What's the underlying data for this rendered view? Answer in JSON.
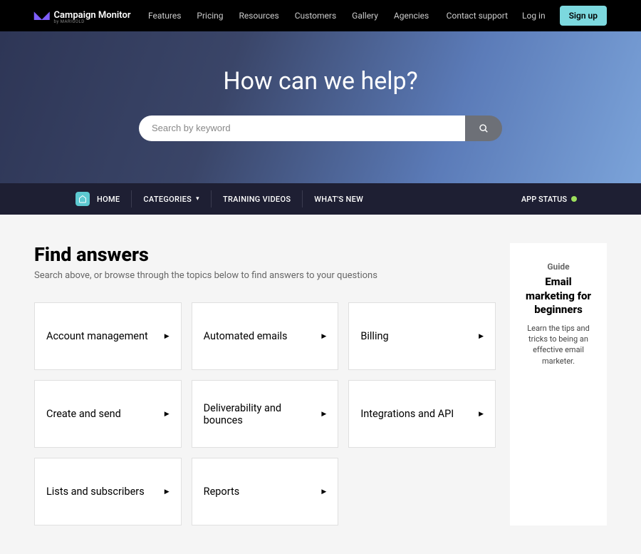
{
  "header": {
    "logo_text": "Campaign Monitor",
    "logo_sub": "by MARIGOLD",
    "nav": [
      "Features",
      "Pricing",
      "Resources",
      "Customers",
      "Gallery",
      "Agencies"
    ],
    "contact": "Contact support",
    "login": "Log in",
    "signup": "Sign up"
  },
  "hero": {
    "title": "How can we help?",
    "search_placeholder": "Search by keyword"
  },
  "subnav": {
    "home": "HOME",
    "categories": "CATEGORIES",
    "training": "TRAINING VIDEOS",
    "whatsnew": "WHAT'S NEW",
    "app_status": "APP STATUS"
  },
  "main": {
    "title": "Find answers",
    "subtitle": "Search above, or browse through the topics below to find answers to your questions",
    "topics": [
      "Account management",
      "Automated emails",
      "Billing",
      "Create and send",
      "Deliverability and bounces",
      "Integrations and API",
      "Lists and subscribers",
      "Reports"
    ]
  },
  "sidebar": {
    "label": "Guide",
    "title": "Email marketing for beginners",
    "desc": "Learn the tips and tricks to being an effective email marketer."
  }
}
